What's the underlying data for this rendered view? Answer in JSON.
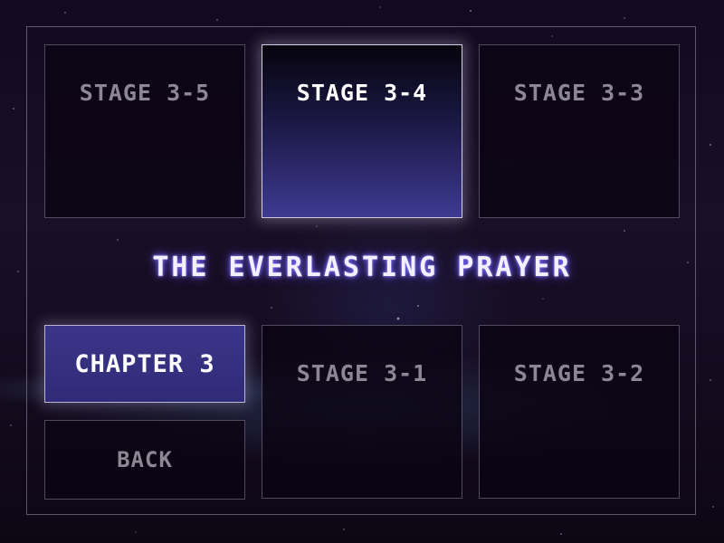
{
  "title": "THE EVERLASTING PRAYER",
  "stages_top": [
    {
      "label": "STAGE 3-5"
    },
    {
      "label": "STAGE 3-4"
    },
    {
      "label": "STAGE 3-3"
    }
  ],
  "stages_bottom": [
    {
      "label": "STAGE 3-1"
    },
    {
      "label": "STAGE 3-2"
    }
  ],
  "chapter": {
    "label": "CHAPTER 3"
  },
  "back": {
    "label": "BACK"
  },
  "selected_stage": "STAGE 3-4",
  "colors": {
    "accent_selected": "#3e3a92",
    "title_glow": "#7a6cff",
    "inactive_text": "#8d8794"
  }
}
